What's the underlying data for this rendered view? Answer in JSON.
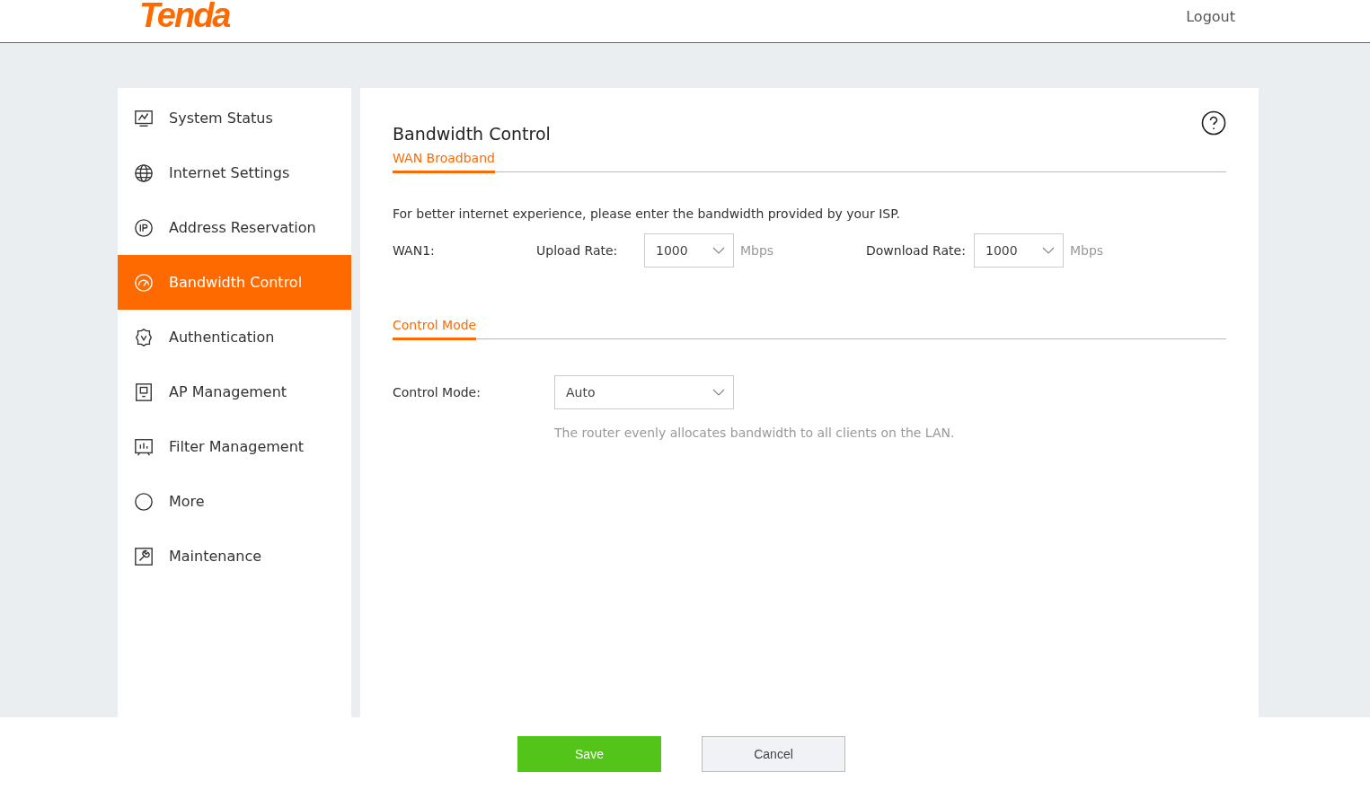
{
  "header": {
    "logo": "Tenda",
    "logout": "Logout"
  },
  "sidebar": {
    "items": [
      {
        "label": "System Status",
        "selected": false
      },
      {
        "label": "Internet Settings",
        "selected": false
      },
      {
        "label": "Address Reservation",
        "selected": false
      },
      {
        "label": "Bandwidth Control",
        "selected": true
      },
      {
        "label": "Authentication",
        "selected": false
      },
      {
        "label": "AP Management",
        "selected": false
      },
      {
        "label": "Filter Management",
        "selected": false
      },
      {
        "label": "More",
        "selected": false
      },
      {
        "label": "Maintenance",
        "selected": false
      }
    ]
  },
  "page": {
    "title": "Bandwidth Control",
    "wan_section": {
      "tab": "WAN Broadband",
      "intro": "For better internet experience, please enter the bandwidth provided by your ISP.",
      "wan_label": "WAN1:",
      "upload_label": "Upload Rate:",
      "upload_value": "1000",
      "upload_unit": "Mbps",
      "download_label": "Download Rate:",
      "download_value": "1000",
      "download_unit": "Mbps"
    },
    "mode_section": {
      "tab": "Control Mode",
      "label": "Control Mode:",
      "value": "Auto",
      "hint": "The router evenly allocates bandwidth to all clients on the LAN."
    }
  },
  "footer": {
    "buttons": [
      {
        "label": "Save",
        "kind": "primary"
      },
      {
        "label": "Cancel",
        "kind": "secondary"
      }
    ]
  }
}
